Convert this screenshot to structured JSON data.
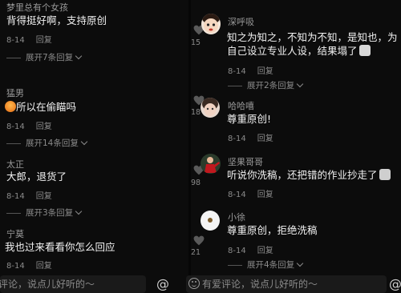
{
  "left": {
    "comments": [
      {
        "user": "梦里总有个女孩",
        "text": "背得挺好啊，支持原创",
        "date": "8-14",
        "reply": "回复",
        "expand": "展开7条回复"
      },
      {
        "user": "猛男",
        "text": "所以在偷瞄吗",
        "date": "8-14",
        "reply": "回复",
        "expand": "展开14条回复"
      },
      {
        "user": "太正",
        "text": "大郎，退货了",
        "date": "8-14",
        "reply": "回复",
        "expand": "展开3条回复"
      },
      {
        "user": "宁莫",
        "text": "我也过来看看你怎么回应",
        "date": "8-14",
        "reply": "回复"
      }
    ],
    "input_placeholder": "评论，说点儿好听的～",
    "at_symbol": "@"
  },
  "right": {
    "comments": [
      {
        "user": "深呼吸",
        "text_line1": "知之为知之，不知为不知，是知也，为",
        "text_line2": "自己设立专业人设，结果塌了",
        "date": "8-14",
        "reply": "回复",
        "expand": "展开2条回复",
        "likes": "15"
      },
      {
        "user": "哈哈嘻",
        "text": "尊重原创!",
        "date": "8-14",
        "reply": "回复",
        "likes": "18"
      },
      {
        "user": "坚果哥哥",
        "text": "听说你洗稿，还把错的作业抄走了",
        "date": "8-14",
        "reply": "回复",
        "likes": "98"
      },
      {
        "user": "小徐",
        "text": "尊重原创，拒绝洗稿",
        "date": "8-14",
        "reply": "回复",
        "expand": "展开4条回复",
        "likes": "21"
      }
    ],
    "input_placeholder": "有爱评论，说点儿好听的～",
    "at_symbol": "@"
  }
}
